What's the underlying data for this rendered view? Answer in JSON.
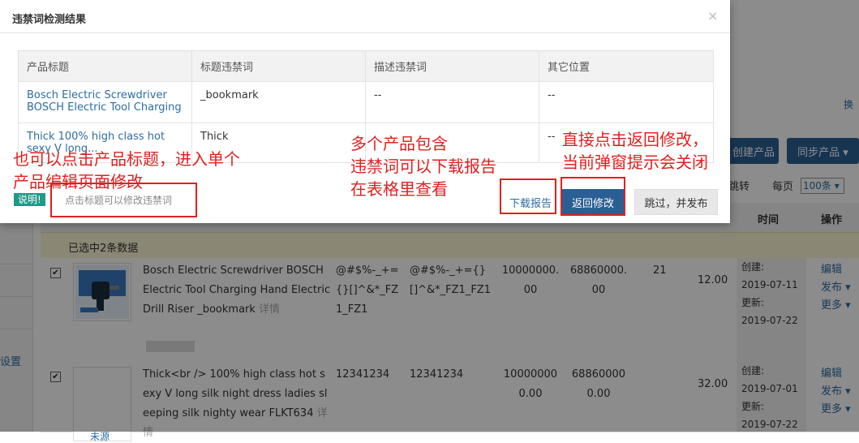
{
  "background": {
    "right_strip_link": "换",
    "buttons": {
      "create_product": "创建产品",
      "sync_product": "同步产品 ▾"
    },
    "toolbar": {
      "jump": "跳转",
      "per_page_label": "每页",
      "per_page_value": "100条 ▾"
    },
    "table": {
      "col_time": "时间",
      "col_ops": "操作",
      "selected_info": "已选中2条数据",
      "rows": [
        {
          "checked": "✔",
          "title": "Bosch Electric Screwdriver BOSCH Electric Tool Charging Hand Electric Drill Riser _bookmark",
          "detail": "详情",
          "sku": "@#$%-_+={}[]^&*_FZ1_FZ1",
          "sku2": "@#$%-_+={}[]^&*_FZ1_FZ1",
          "num1": "10000000.00",
          "num2": "68860000.00",
          "qty": "21",
          "price": "12.00",
          "created_label": "创建:",
          "created": "2019-07-11",
          "updated_label": "更新:",
          "updated": "2019-07-22",
          "op_edit": "编辑",
          "op_publish": "发布 ▾",
          "op_more": "更多 ▾"
        },
        {
          "checked": "✔",
          "title": "Thick<br /> 100% high class hot sexy V long silk night dress ladies sleeping silk nighty wear FLKT634",
          "detail": "详情",
          "sku": "12341234",
          "sku2": "12341234",
          "num1": "100000000.00",
          "num2": "688600000.00",
          "price": "32.00",
          "created_label": "创建:",
          "created": "2019-07-01",
          "updated_label": "更新:",
          "updated": "2019-07-22",
          "op_edit": "编辑",
          "op_publish": "发布 ▾",
          "op_more": "更多 ▾",
          "thumb_text": "未源"
        }
      ]
    },
    "left_rail": {
      "settings": "设置"
    }
  },
  "modal": {
    "title": "违禁词检测结果",
    "close": "×",
    "headers": [
      "产品标题",
      "标题违禁词",
      "描述违禁词",
      "其它位置"
    ],
    "rows": [
      {
        "title": "Bosch Electric Screwdriver BOSCH Electric Tool Charging Hand...",
        "title_words": "_bookmark",
        "desc_words": "--",
        "other": "--"
      },
      {
        "title": "Thick 100% high class hot sexy V long...",
        "title_words": "Thick",
        "desc_words": "",
        "other": "--"
      }
    ],
    "note_badge": "说明!",
    "note_text": "点击标题可以修改违禁词",
    "download_report": "下载报告",
    "return_edit": "返回修改",
    "skip_publish": "跳过，并发布"
  },
  "annotations": {
    "left_line1": "也可以点击产品标题，进入单个",
    "left_line2": "产品编辑页面修改",
    "mid_line1": "多个产品包含",
    "mid_line2": "违禁词可以下载报告",
    "mid_line3": "在表格里查看",
    "right_line1": "直接点击返回修改，",
    "right_line2": "当前弹窗提示会关闭"
  },
  "colors": {
    "primary": "#2b5f94",
    "link": "#2d6ca2",
    "annotation": "#e02020",
    "badge": "#1f9989",
    "selected_bar": "#fcf6d6"
  }
}
